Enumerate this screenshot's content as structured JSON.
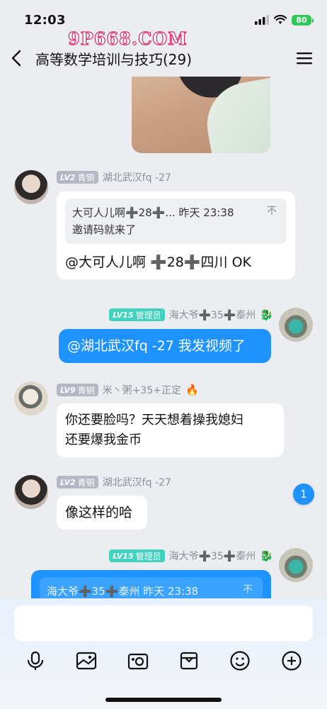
{
  "status": {
    "time": "12:03",
    "battery": "80"
  },
  "watermark": "9P668.COM",
  "header": {
    "title": "高等数学培训与技巧(29)"
  },
  "messages": [
    {
      "sender": "湖北武汉fq -27",
      "level": "LV2",
      "rank": "青铜",
      "quote_header": "大可人儿啊➕28➕... 昨天 23:38",
      "quote_body": "邀请码就来了",
      "pin": "不",
      "text": "@大可人儿啊 ➕28➕四川 OK"
    },
    {
      "sender": "海大爷➕35➕泰州",
      "level": "LV15",
      "rank": "管理员",
      "text": "@湖北武汉fq -27 我发视频了"
    },
    {
      "sender": "米丶粥+35+正定",
      "level": "LV9",
      "rank": "青铜",
      "text_line1": "你还要脸吗？天天想着操我媳妇",
      "text_line2": "还要爆我金币"
    },
    {
      "sender": "湖北武汉fq -27",
      "level": "LV2",
      "rank": "青铜",
      "text": "像这样的哈"
    },
    {
      "sender": "海大爷➕35➕泰州",
      "level": "LV15",
      "rank": "管理员",
      "quote_header": "海大爷➕35➕泰州 昨天 23:38",
      "pin": "不"
    }
  ],
  "unread_count": "1",
  "composer": {
    "placeholder": ""
  },
  "toolbar_icons": [
    "microphone-icon",
    "image-icon",
    "camera-icon",
    "bag-icon",
    "emoji-icon",
    "plus-icon"
  ],
  "colors": {
    "bubble_blue": "#1e93ff",
    "level_teal": "#3fd2bd",
    "level_gray": "#b3b8c4"
  }
}
